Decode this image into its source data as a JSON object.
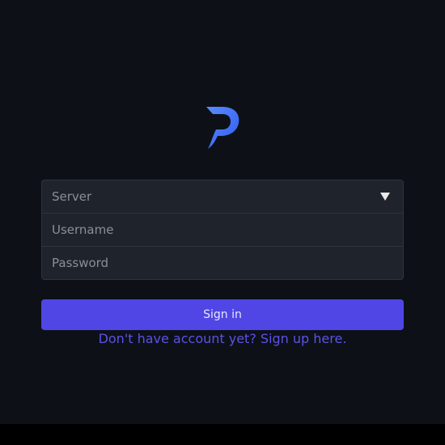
{
  "app": {
    "background_color": "#0d1017",
    "logo_icon": "app-logo-p-icon"
  },
  "login_form": {
    "server": {
      "placeholder": "Server",
      "value": ""
    },
    "username": {
      "placeholder": "Username",
      "value": ""
    },
    "password": {
      "placeholder": "Password",
      "value": ""
    }
  },
  "actions": {
    "sign_in_label": "Sign in",
    "sign_up_link": "Don't have account yet? Sign up here.",
    "accent_color": "#4f46e5"
  }
}
